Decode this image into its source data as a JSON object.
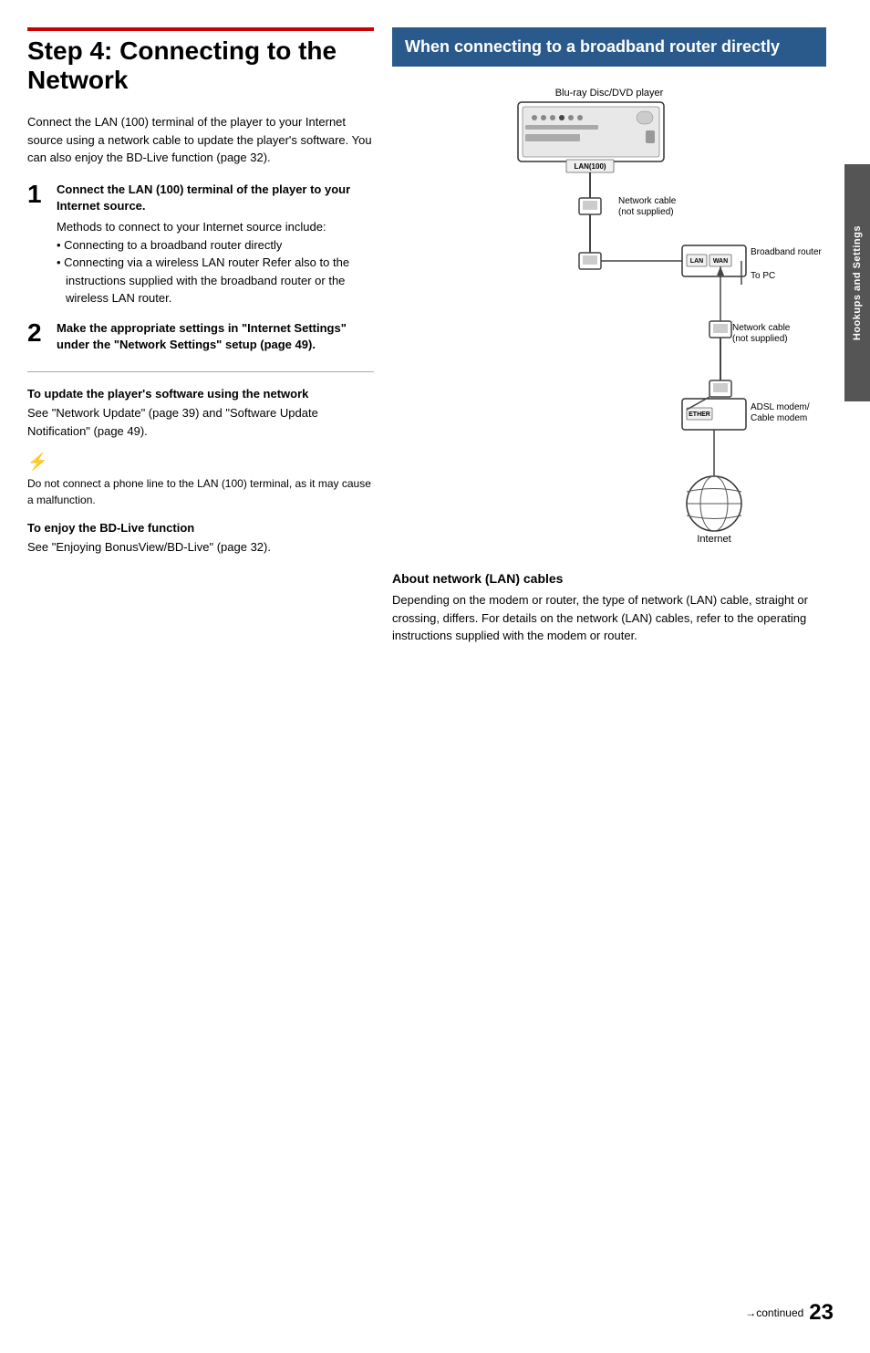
{
  "page": {
    "title": "Step 4: Connecting to the Network",
    "intro": "Connect the LAN (100) terminal of the player to your Internet source using a network cable to update the player's software. You can also enjoy the BD-Live function (page 32).",
    "steps": [
      {
        "number": "1",
        "title": "Connect the LAN (100) terminal of the player to your Internet source.",
        "body": "Methods to connect to your Internet source include:",
        "bullets": [
          "Connecting to a broadband router directly",
          "Connecting via a wireless LAN router Refer also to the instructions supplied with the broadband router or the wireless LAN router."
        ]
      },
      {
        "number": "2",
        "title": "Make the appropriate settings in \"Internet Settings\" under the \"Network Settings\" setup (page 49)."
      }
    ],
    "update_heading": "To update the player's software using the network",
    "update_text": "See \"Network Update\" (page 39) and \"Software Update Notification\" (page 49).",
    "warning_icon": "⚡",
    "warning_text": "Do not connect a phone line to the LAN (100) terminal, as it may cause a malfunction.",
    "bdlive_heading": "To enjoy the BD-Live function",
    "bdlive_text": "See \"Enjoying BonusView/BD-Live\" (page 32)."
  },
  "right": {
    "header": "When connecting to a broadband router directly",
    "labels": {
      "player": "Blu-ray Disc/DVD player",
      "network_cable_1": "Network cable\n(not supplied)",
      "broadband_router": "Broadband router",
      "to_pc": "To PC",
      "network_cable_2": "Network cable\n(not supplied)",
      "adsl_modem": "ADSL modem/\nCable modem",
      "internet": "Internet",
      "lan100": "LAN(100)",
      "lan": "LAN",
      "wan": "WAN",
      "ether": "ETHER"
    },
    "about_heading": "About network (LAN) cables",
    "about_text": "Depending on the modem or router, the type of network (LAN) cable, straight or crossing, differs. For details on the network (LAN) cables, refer to the operating instructions supplied with the modem or router."
  },
  "footer": {
    "continued": "→continued",
    "page_number": "23"
  },
  "sidebar": {
    "label": "Hookups and Settings"
  }
}
